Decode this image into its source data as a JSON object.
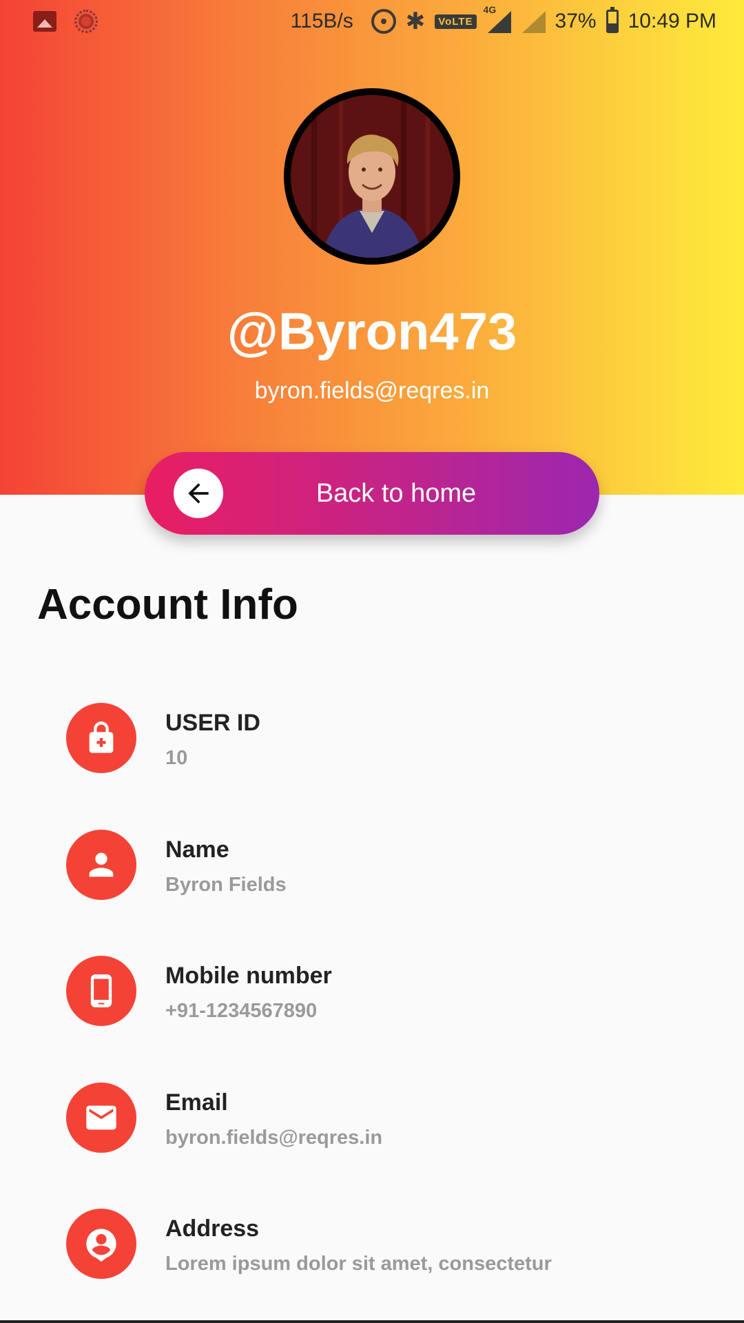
{
  "status_bar": {
    "icons_left": [
      "gallery-icon",
      "sync-spinner-icon"
    ],
    "net_speed": "115B/s",
    "icons_right": [
      "hotspot-icon",
      "bluetooth-icon",
      "volte-icon",
      "signal-4g-icon",
      "signal-no-service-icon",
      "battery-charging-icon"
    ],
    "volte_label": "VoLTE",
    "network_type": "4G",
    "battery": "37%",
    "time": "10:49 PM"
  },
  "profile": {
    "username": "@Byron473",
    "email": "byron.fields@reqres.in"
  },
  "back_button": {
    "label": "Back to home",
    "icon": "arrow-left-icon"
  },
  "section_title": "Account Info",
  "account_info": [
    {
      "label": "USER ID",
      "value": "10",
      "icon": "lock-icon"
    },
    {
      "label": "Name",
      "value": "Byron Fields",
      "icon": "person-icon"
    },
    {
      "label": "Mobile number",
      "value": "+91-1234567890",
      "icon": "phone-icon"
    },
    {
      "label": "Email",
      "value": "byron.fields@reqres.in",
      "icon": "mail-icon"
    },
    {
      "label": "Address",
      "value": "Lorem ipsum dolor sit amet, consectetur",
      "icon": "location-person-icon"
    }
  ],
  "colors": {
    "header_gradient_start": "#f44336",
    "header_gradient_end": "#ffeb3b",
    "button_gradient_start": "#e91e63",
    "button_gradient_end": "#9c27b0",
    "icon_circle": "#f44336"
  }
}
